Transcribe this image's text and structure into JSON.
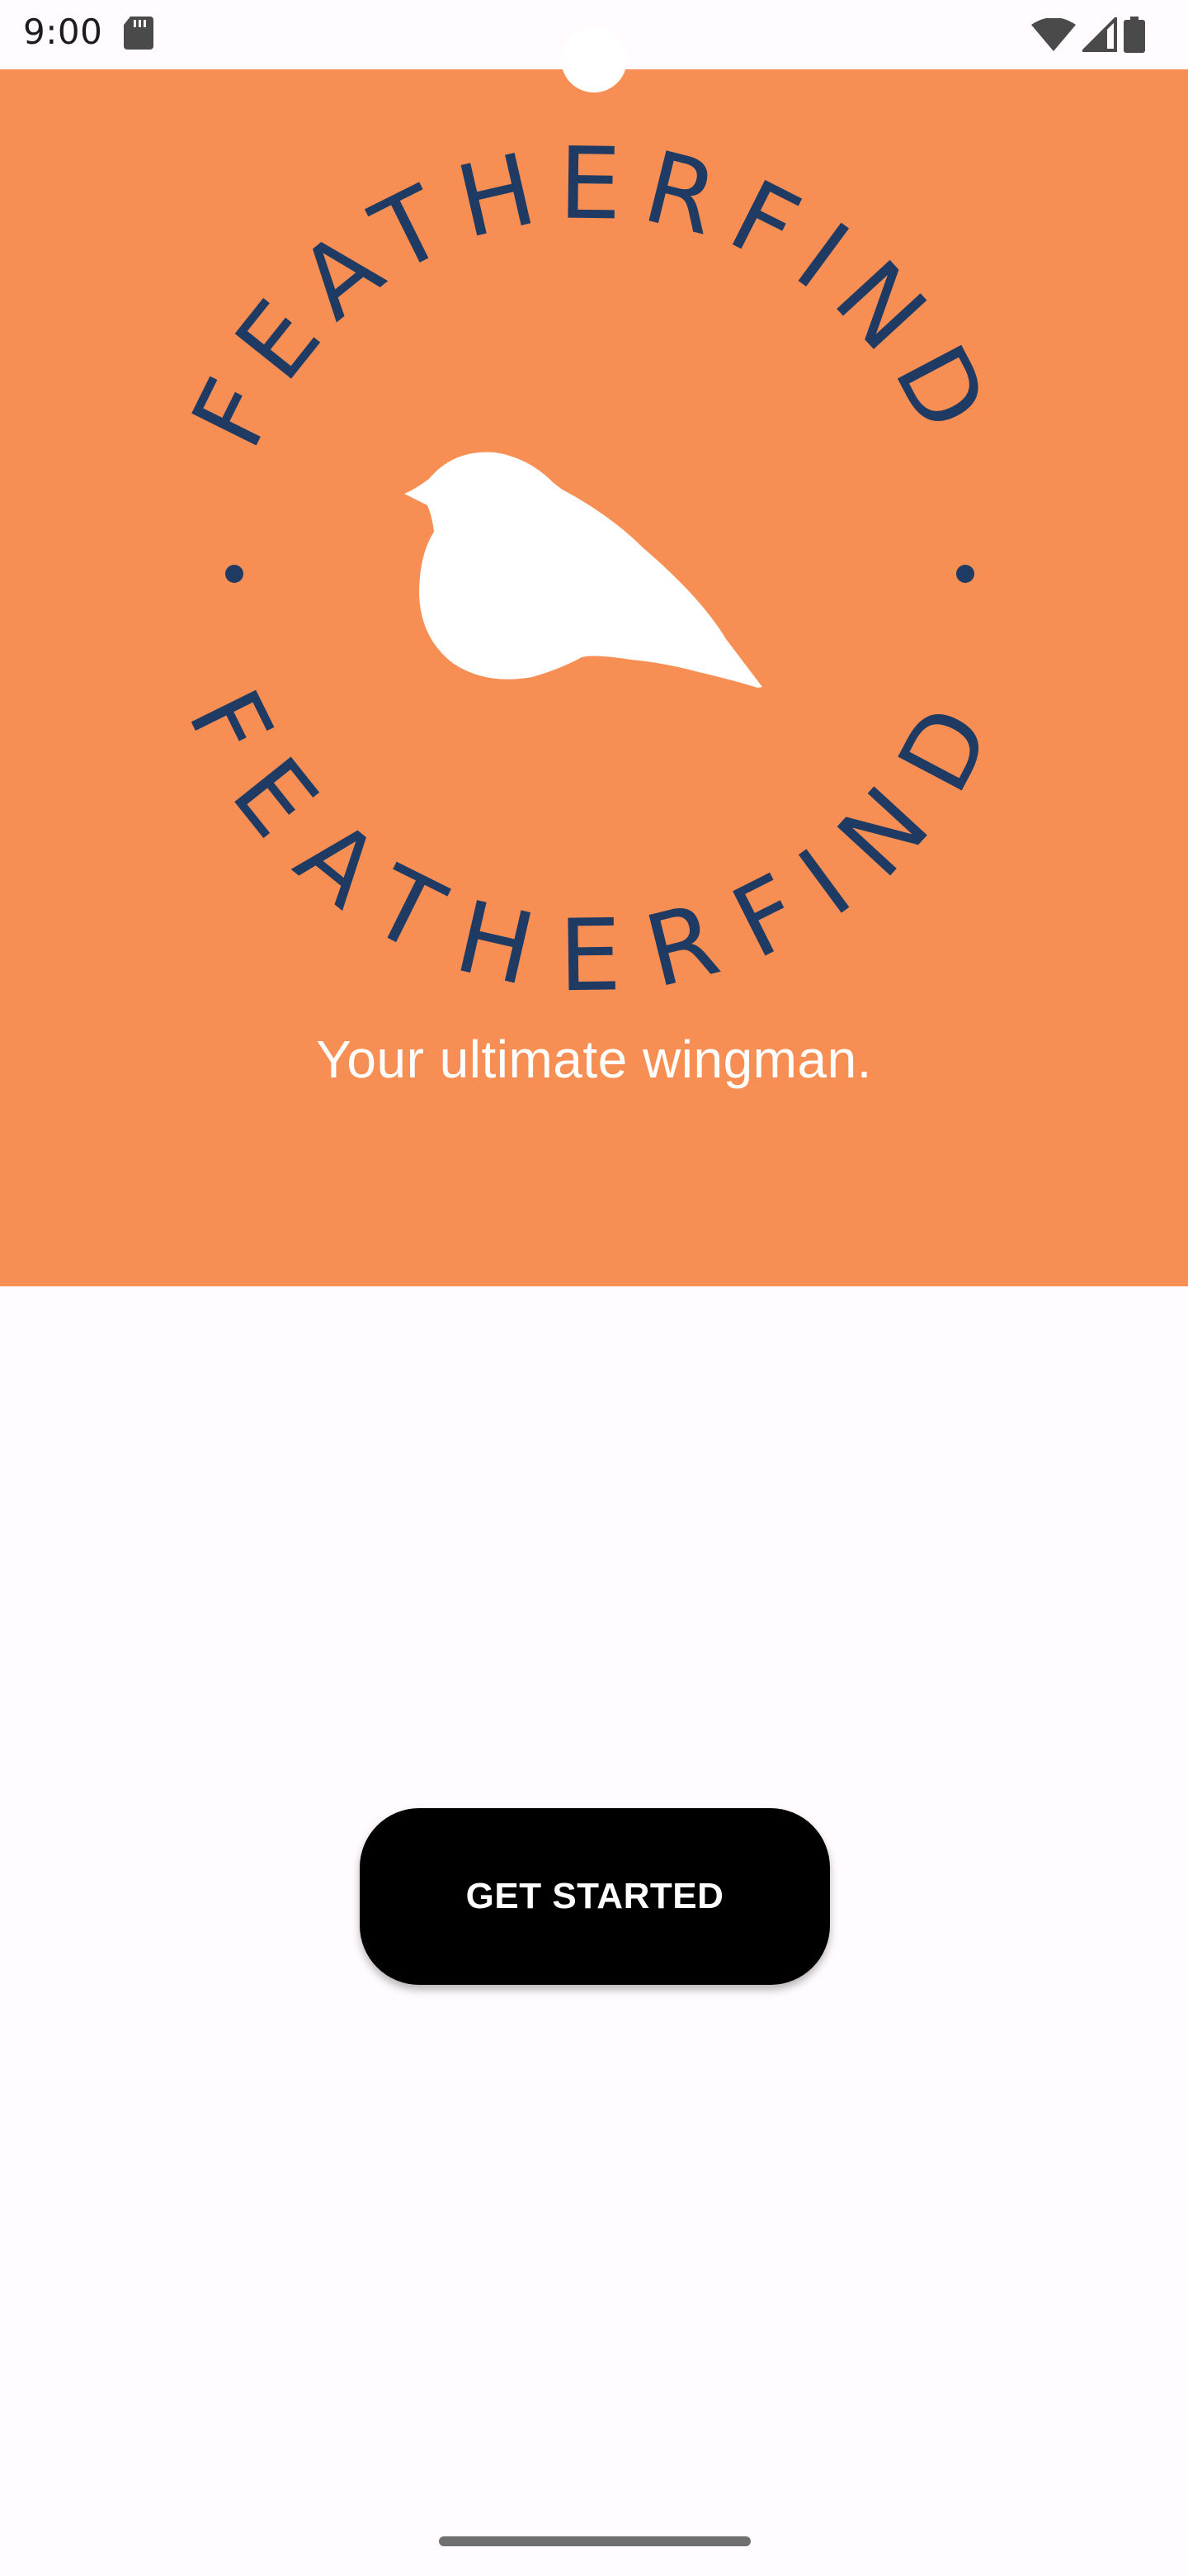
{
  "status_bar": {
    "time": "9:00",
    "icons": [
      "sd-card-icon",
      "wifi-icon",
      "cell-signal-icon",
      "battery-icon"
    ]
  },
  "hero": {
    "background_color": "#f78f55",
    "logo": {
      "top_text": "FEATHERFIND",
      "bottom_text": "FEATHERFIND",
      "text_color": "#1f3b63",
      "bird_color": "#ffffff"
    },
    "tagline": "Your ultimate wingman."
  },
  "main": {
    "get_started_label": "GET STARTED"
  },
  "colors": {
    "accent": "#f78f55",
    "logo_text": "#1f3b63",
    "button_bg": "#000000",
    "button_text": "#ffffff",
    "page_bg": "#fffbfe"
  }
}
